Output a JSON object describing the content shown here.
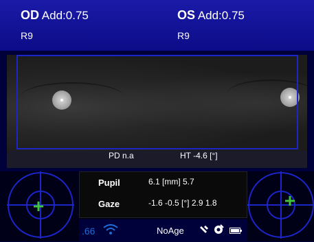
{
  "header": {
    "od": {
      "side": "OD",
      "add": "Add:0.75",
      "sub": "R9"
    },
    "os": {
      "side": "OS",
      "add": "Add:0.75",
      "sub": "R9"
    }
  },
  "camera": {
    "pd": "PD n.a",
    "ht": "HT -4.6 [°]"
  },
  "readout": {
    "pupil_label": "Pupil",
    "pupil_value": "6.1 [mm] 5.7",
    "gaze_label": "Gaze",
    "gaze_value": "-1.6  -0.5 [°] 2.9  1.8"
  },
  "status": {
    "number": ".66",
    "age": "NoAge",
    "icons": [
      "wifi-icon",
      "tool-icon",
      "camera-gear-icon",
      "battery-icon"
    ]
  },
  "colors": {
    "header_blue": "#1a1aa8",
    "roi_blue": "#1b25c8",
    "target_green": "#43c23b",
    "target_blue": "#1b25c8",
    "status_blue": "#1e6cd6"
  }
}
